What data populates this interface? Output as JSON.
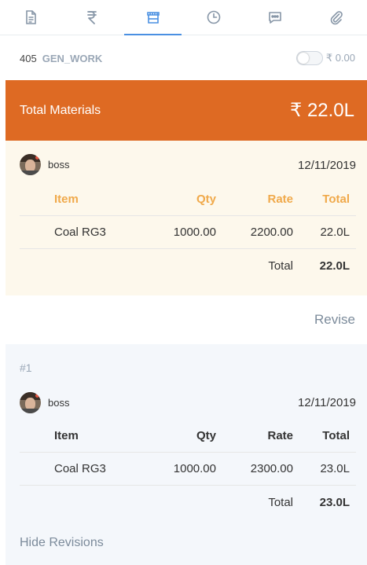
{
  "tabs": [
    {
      "icon": "document-icon",
      "active": false
    },
    {
      "icon": "rupee-icon",
      "active": false
    },
    {
      "icon": "store-icon",
      "active": true
    },
    {
      "icon": "clock-icon",
      "active": false
    },
    {
      "icon": "chat-icon",
      "active": false
    },
    {
      "icon": "attachment-icon",
      "active": false
    }
  ],
  "work": {
    "number": "405",
    "name": "GEN_WORK",
    "toggle_on": false,
    "toggle_amount": "₹ 0.00"
  },
  "total": {
    "label": "Total Materials",
    "amount": "₹ 22.0L"
  },
  "current": {
    "user": "boss",
    "date": "12/11/2019",
    "headers": {
      "item": "Item",
      "qty": "Qty",
      "rate": "Rate",
      "total": "Total"
    },
    "rows": [
      {
        "item": "Coal RG3",
        "qty": "1000.00",
        "rate": "2200.00",
        "total": "22.0L"
      }
    ],
    "sum_label": "Total",
    "sum_value": "22.0L"
  },
  "revise_label": "Revise",
  "revision": {
    "label": "#1",
    "user": "boss",
    "date": "12/11/2019",
    "headers": {
      "item": "Item",
      "qty": "Qty",
      "rate": "Rate",
      "total": "Total"
    },
    "rows": [
      {
        "item": "Coal RG3",
        "qty": "1000.00",
        "rate": "2300.00",
        "total": "23.0L"
      }
    ],
    "sum_label": "Total",
    "sum_value": "23.0L"
  },
  "hide_revisions_label": "Hide Revisions",
  "colors": {
    "accent": "#de6a23",
    "tab_active": "#4a90e2",
    "icon": "#8796a7",
    "header_orange": "#f0a94a"
  }
}
